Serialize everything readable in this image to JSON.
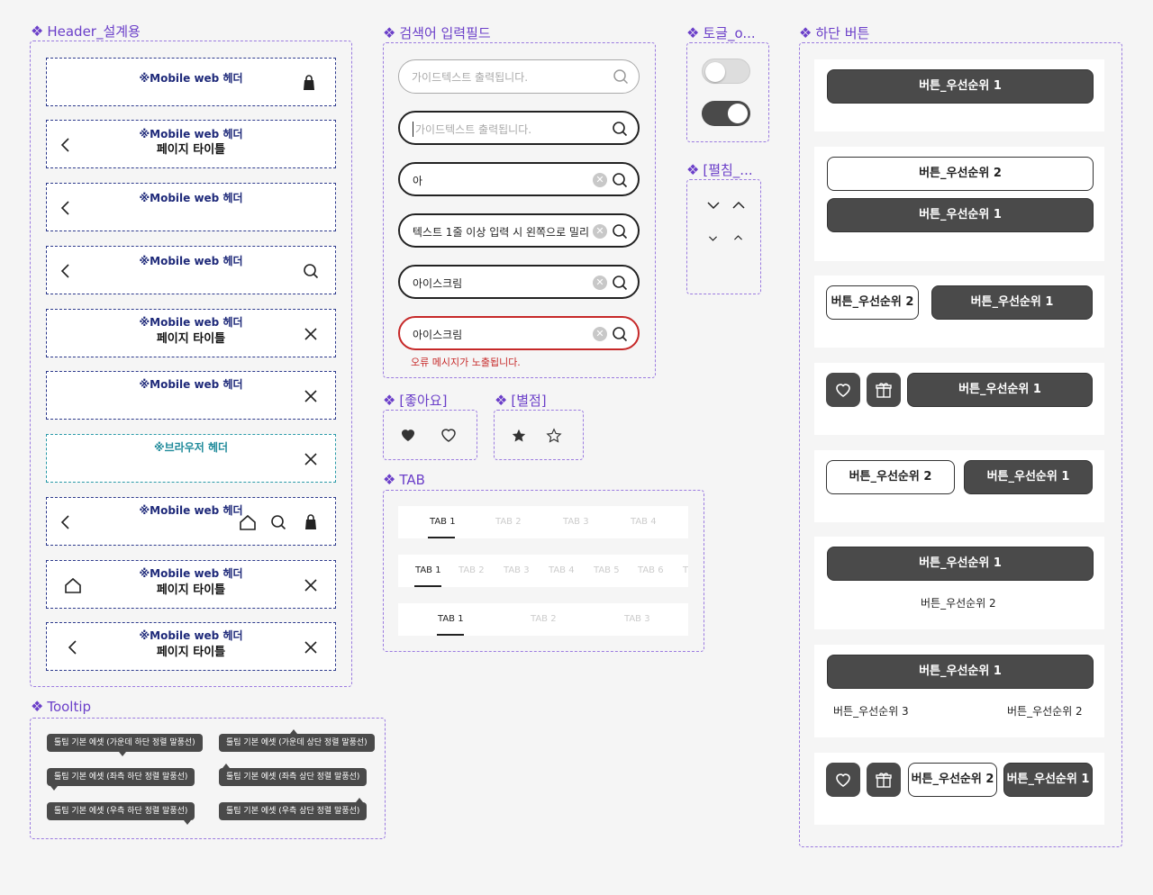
{
  "sections": {
    "header": "Header_설계용",
    "search": "검색어 입력필드",
    "toggle": "토글_o...",
    "bottom_button": "하단 버튼",
    "expand": "[펼침_...",
    "like": "[좋아요]",
    "star": "[별점]",
    "tab": "TAB",
    "tooltip": "Tooltip"
  },
  "headers": {
    "mobile": "※Mobile web 헤더",
    "browser": "※브라우저 헤더",
    "page_title": "페이지 타이틀"
  },
  "search": {
    "placeholder": "가이드텍스트 출력됩니다.",
    "placeholder_focus": "가이드텍스트 출력됩니다.",
    "typing": "아",
    "long": "텍스트 1줄 이상 입력 시 왼쪽으로 밀리",
    "filled": "아이스크림",
    "error_value": "아이스크림",
    "error_msg": "오류 메시지가 노출됩니다."
  },
  "tabs": {
    "row1": [
      "TAB 1",
      "TAB 2",
      "TAB 3",
      "TAB 4"
    ],
    "row2": [
      "TAB 1",
      "TAB 2",
      "TAB 3",
      "TAB 4",
      "TAB 5",
      "TAB 6",
      "T"
    ],
    "row3": [
      "TAB 1",
      "TAB 2",
      "TAB 3"
    ]
  },
  "buttons": {
    "p1": "버튼_우선순위 1",
    "p2": "버튼_우선순위 2",
    "p3": "버튼_우선순위 3"
  },
  "tooltips": {
    "center_bottom": "툴팁 기본 에셋 (가운데 하단 정렬 말풍선)",
    "center_top": "툴팁 기본 에셋 (가운데 상단 정렬 말풍선)",
    "left_bottom": "툴팁 기본 에셋 (좌측 하단 정렬 말풍선)",
    "left_top": "툴팁 기본 에셋 (좌측 상단 정렬 말풍선)",
    "right_bottom": "툴팁 기본 에셋 (우측 하단 정렬 말풍선)",
    "right_top": "툴팁 기본 에셋 (우측 상단 정렬 말풍선)"
  },
  "colors": {
    "accent": "#6b3fc9",
    "primary_button": "#4a4a4a",
    "error": "#c62828",
    "header_border": "#2d3a8c"
  }
}
